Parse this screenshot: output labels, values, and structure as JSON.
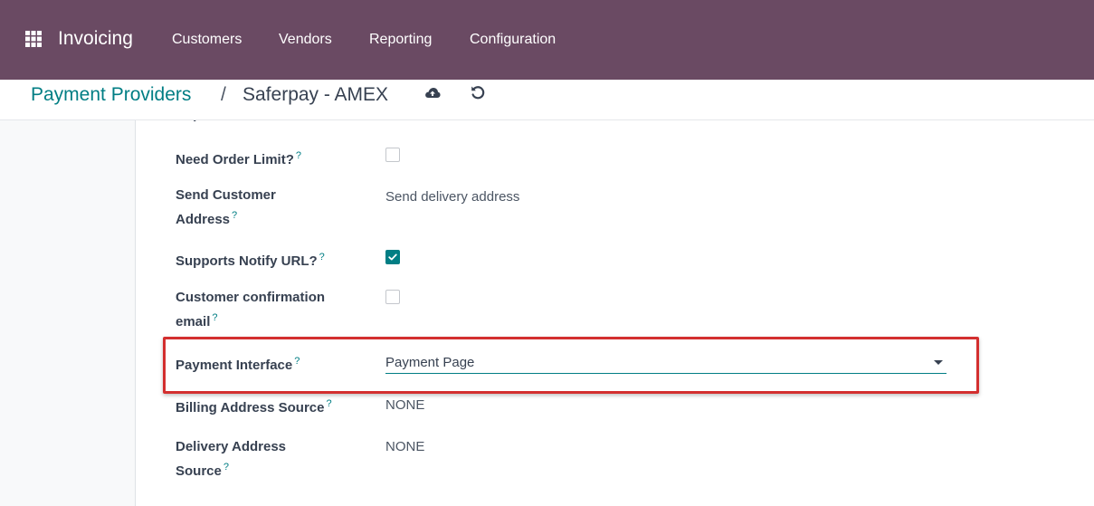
{
  "navbar": {
    "app_name": "Invoicing",
    "menu": [
      "Customers",
      "Vendors",
      "Reporting",
      "Configuration"
    ],
    "apps_icon": "grid-apps-icon",
    "background_color": "#6a4a63"
  },
  "breadcrumb": {
    "parent": "Payment Providers",
    "separator": "/",
    "current": "Saferpay - AMEX",
    "save_icon": "cloud-upload-icon",
    "discard_icon": "undo-icon"
  },
  "form": {
    "cut_off_label": "Capture",
    "fields": [
      {
        "label": "Need Order Limit?",
        "help": "?",
        "type": "checkbox",
        "checked": false
      },
      {
        "label": "Send Customer Address",
        "help": "?",
        "type": "text",
        "value": "Send delivery address"
      },
      {
        "label": "Supports Notify URL?",
        "help": "?",
        "type": "checkbox",
        "checked": true
      },
      {
        "label": "Customer confirmation email",
        "help": "?",
        "type": "checkbox",
        "checked": false
      },
      {
        "label": "Payment Interface",
        "help": "?",
        "type": "select",
        "value": "Payment Page"
      },
      {
        "label": "Billing Address Source",
        "help": "?",
        "type": "text",
        "value": "NONE"
      },
      {
        "label": "Delivery Address Source",
        "help": "?",
        "type": "text",
        "value": "NONE"
      }
    ]
  },
  "colors": {
    "accent": "#017e84",
    "highlight": "#d32f2f"
  }
}
